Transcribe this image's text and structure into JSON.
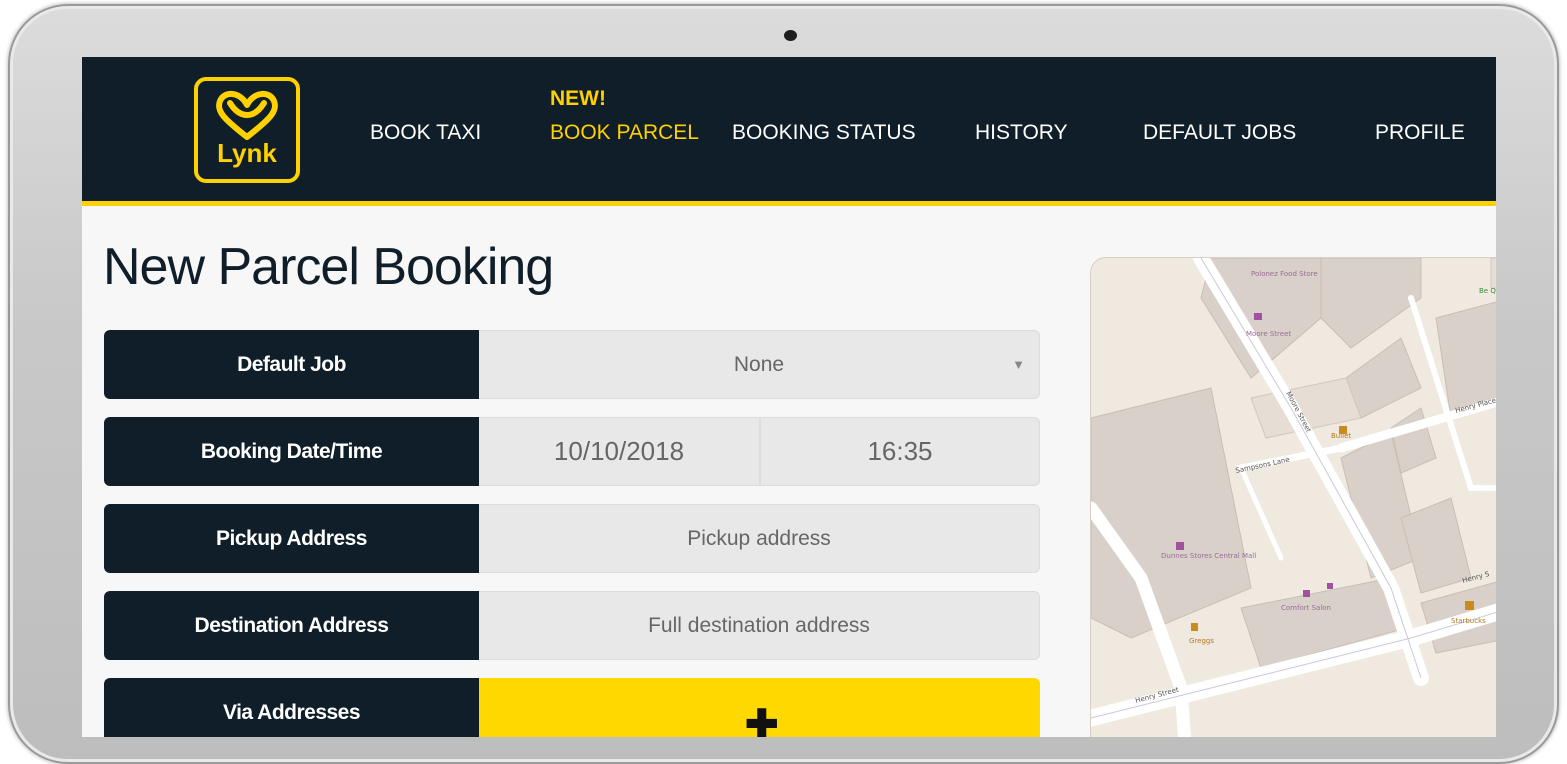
{
  "brand": {
    "logo_text": "Lynk",
    "accent": "#ffd100",
    "navbar_bg": "#0f1e29"
  },
  "nav": {
    "new_badge": "NEW!",
    "items": [
      {
        "label": "BOOK TAXI"
      },
      {
        "label": "BOOK PARCEL",
        "active": true
      },
      {
        "label": "BOOKING STATUS"
      },
      {
        "label": "HISTORY"
      },
      {
        "label": "DEFAULT JOBS"
      },
      {
        "label": "PROFILE"
      }
    ]
  },
  "page": {
    "title": "New Parcel Booking"
  },
  "form": {
    "default_job": {
      "label": "Default Job",
      "value": "None"
    },
    "booking_datetime": {
      "label": "Booking Date/Time",
      "date": "10/10/2018",
      "time": "16:35"
    },
    "pickup": {
      "label": "Pickup Address",
      "placeholder": "Pickup address"
    },
    "destination": {
      "label": "Destination Address",
      "placeholder": "Full destination address"
    },
    "via": {
      "label": "Via Addresses",
      "add_icon": "plus-icon"
    }
  },
  "map": {
    "labels": {
      "poi_top": "Polonez Food Store",
      "stop_moore": "Moore Street",
      "moore_street": "Moore Street",
      "sampsons_lane": "Sampsons Lane",
      "henry_place": "Henry Place",
      "henry_street_bl": "Henry Street",
      "henry_street_r": "Henry S",
      "dunnes": "Dunnes Stores Central Mall",
      "comfort": "Comfort Salon",
      "bullet": "Bullet",
      "starbucks": "Starbucks",
      "greggs": "Greggs",
      "be_q": "Be Quick Emp"
    }
  }
}
